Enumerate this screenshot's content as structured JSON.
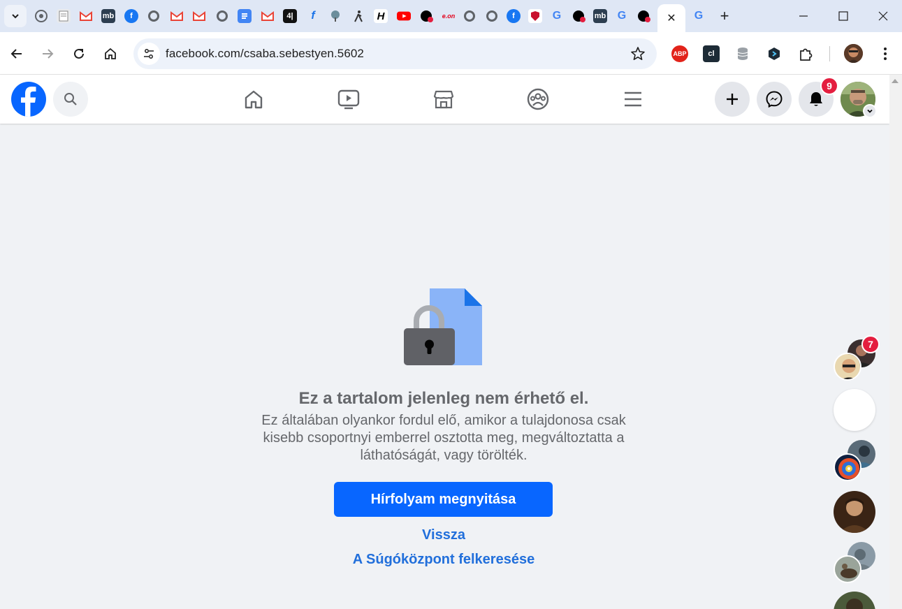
{
  "browser": {
    "active_tab_close_label": "✕",
    "new_tab_label": "+",
    "url": "facebook.com/csaba.sebestyen.5602",
    "tab_favicons": [
      "chrome-icon",
      "doc-icon",
      "gmail-icon",
      "mb-icon",
      "facebook-icon",
      "globe-icon",
      "gmail-icon",
      "gmail-icon",
      "globe-icon",
      "docs-icon",
      "gmail-icon",
      "444-icon",
      "f-icon",
      "tree-icon",
      "walker-icon",
      "h-icon",
      "youtube-icon",
      "dot-icon",
      "eon-icon",
      "globe-icon",
      "globe-icon",
      "facebook-icon",
      "shield-icon",
      "google-icon",
      "dot-icon",
      "mb-icon",
      "google-icon",
      "dot-icon",
      "google-icon"
    ],
    "tab_texts": {
      "mb": "mb",
      "444": "4|",
      "h": "H",
      "eon": "e.on",
      "g": "G"
    },
    "extensions": {
      "abp": "ABP",
      "cl": "cl"
    }
  },
  "facebook": {
    "notifications_count": "9",
    "colors": {
      "brand": "#0866ff",
      "badge": "#e41e3f",
      "link": "#216fdb",
      "text_secondary": "#65676b"
    }
  },
  "content": {
    "title": "Ez a tartalom jelenleg nem érhető el.",
    "description": "Ez általában olyankor fordul elő, amikor a tulajdonosa csak kisebb csoportnyi emberrel osztotta meg, megváltoztatta a láthatóságát, vagy törölték.",
    "primary_button": "Hírfolyam megnyitása",
    "back_link": "Vissza",
    "help_link": "A Súgóközpont felkeresése"
  },
  "chat": {
    "unread_count": "7"
  }
}
